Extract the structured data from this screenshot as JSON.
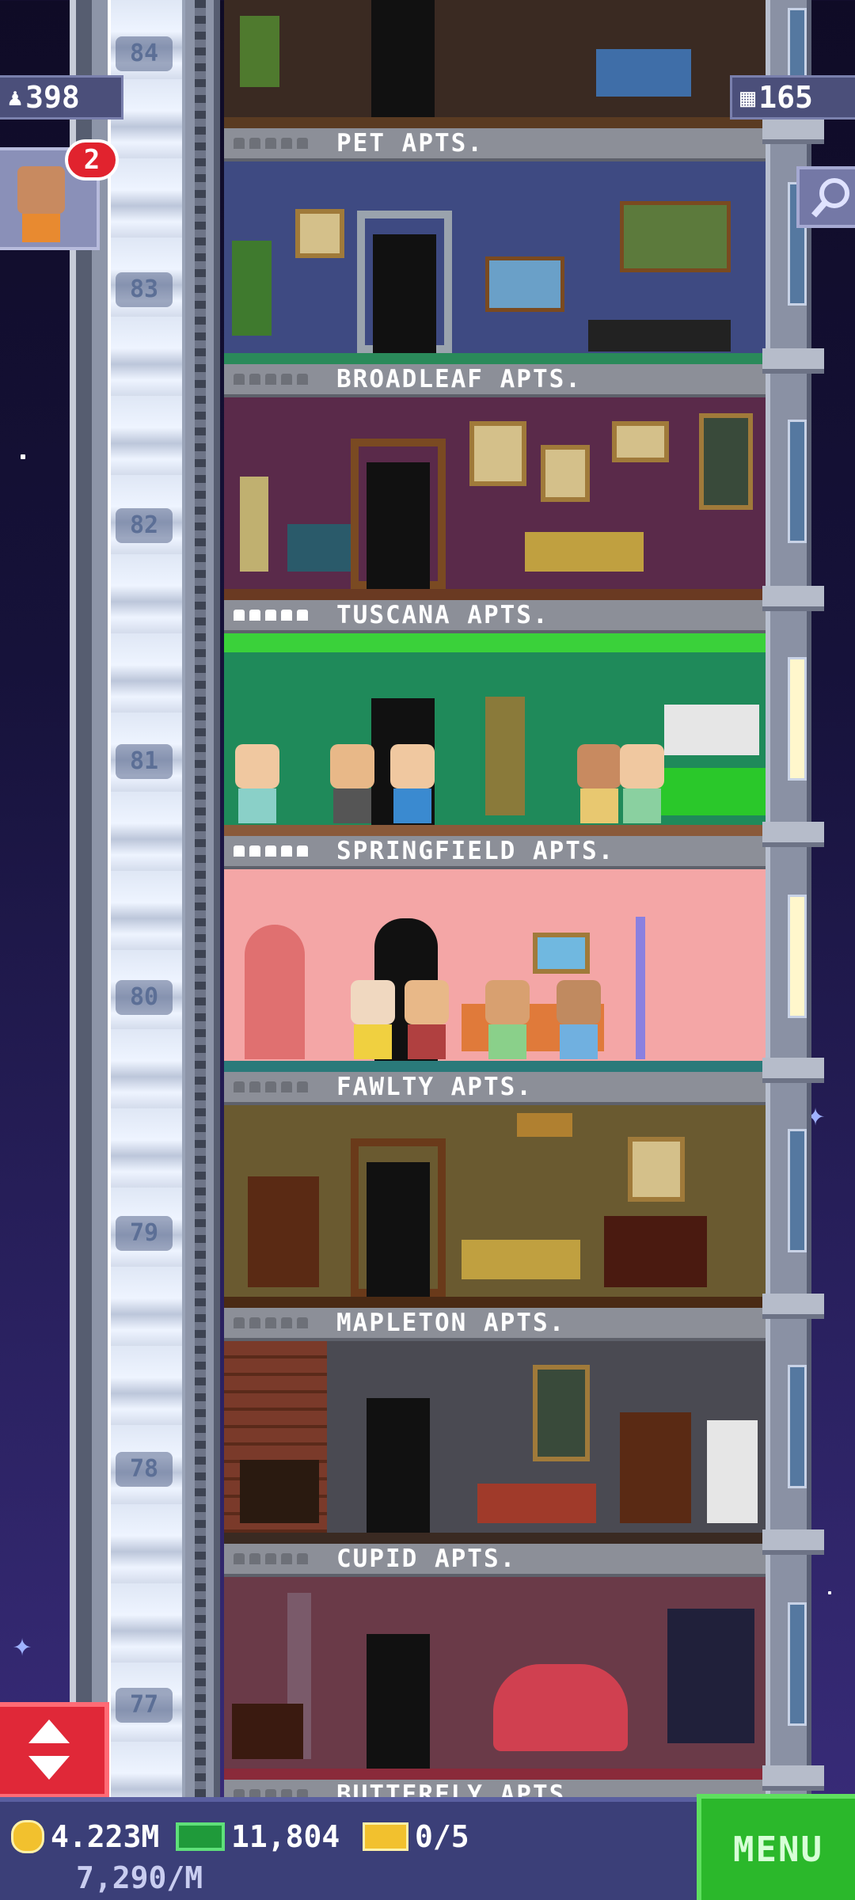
{
  "hud": {
    "population": "398",
    "floors": "165",
    "visitor_badge": "2"
  },
  "shaft_numbers": [
    "84",
    "83",
    "82",
    "81",
    "80",
    "79",
    "78",
    "77"
  ],
  "floors": [
    {
      "name": "PET APTS.",
      "occupied": 0
    },
    {
      "name": "BROADLEAF APTS.",
      "occupied": 0
    },
    {
      "name": "TUSCANA APTS.",
      "occupied": 5
    },
    {
      "name": "SPRINGFIELD APTS.",
      "occupied": 5
    },
    {
      "name": "FAWLTY APTS.",
      "occupied": 0
    },
    {
      "name": "MAPLETON APTS.",
      "occupied": 0
    },
    {
      "name": "CUPID APTS.",
      "occupied": 0
    },
    {
      "name": "BUTTERFLY APTS.",
      "occupied": 0
    }
  ],
  "bottom": {
    "coins": "4.223M",
    "bux": "11,804",
    "tickets": "0/5",
    "income": "7,290/M",
    "menu_label": "MENU"
  },
  "icons": {
    "population": "person-icon",
    "floors": "building-icon",
    "search": "magnifier-icon",
    "elevator": "up-down-arrows-icon",
    "coins": "coin-icon",
    "bux": "bux-icon",
    "tickets": "ticket-icon"
  },
  "colors": {
    "sky_top": "#0f0b26",
    "bottom_bar": "#3b3f78",
    "menu_green": "#2bb82b",
    "elevator_red": "#e02838",
    "badge_red": "#e1232e"
  }
}
